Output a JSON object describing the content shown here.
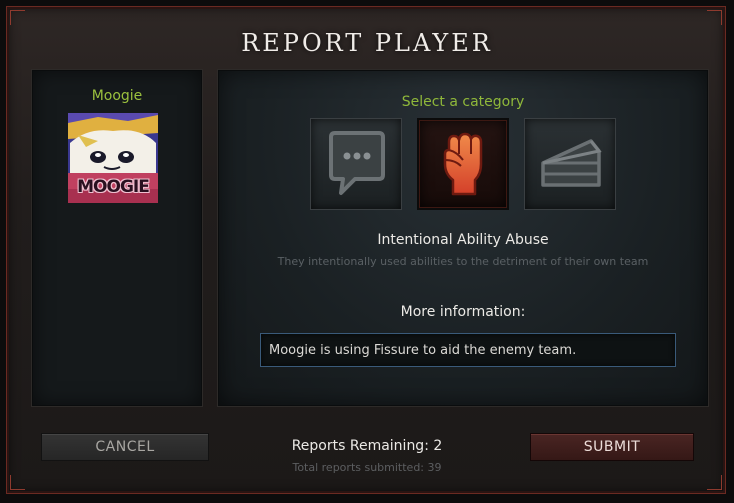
{
  "dialog": {
    "title": "REPORT PLAYER"
  },
  "player": {
    "name": "Moogie",
    "avatar_text": "MOOGIE"
  },
  "category": {
    "heading": "Select a category",
    "options": [
      {
        "icon": "chat-bubble-icon",
        "selected": false
      },
      {
        "icon": "raised-fist-icon",
        "selected": true
      },
      {
        "icon": "cake-slice-icon",
        "selected": false
      }
    ],
    "selected_name": "Intentional Ability Abuse",
    "selected_description": "They intentionally used abilities to the detriment of their own team"
  },
  "more_info": {
    "label": "More information:",
    "value": "Moogie is using Fissure to aid the enemy team."
  },
  "footer": {
    "cancel_label": "CANCEL",
    "submit_label": "SUBMIT",
    "reports_remaining": "Reports Remaining: 2",
    "total_submitted": "Total reports submitted: 39"
  },
  "colors": {
    "accent_green": "#9bc13e",
    "submit_red": "#4a2523",
    "input_border": "#3a5a7a"
  }
}
